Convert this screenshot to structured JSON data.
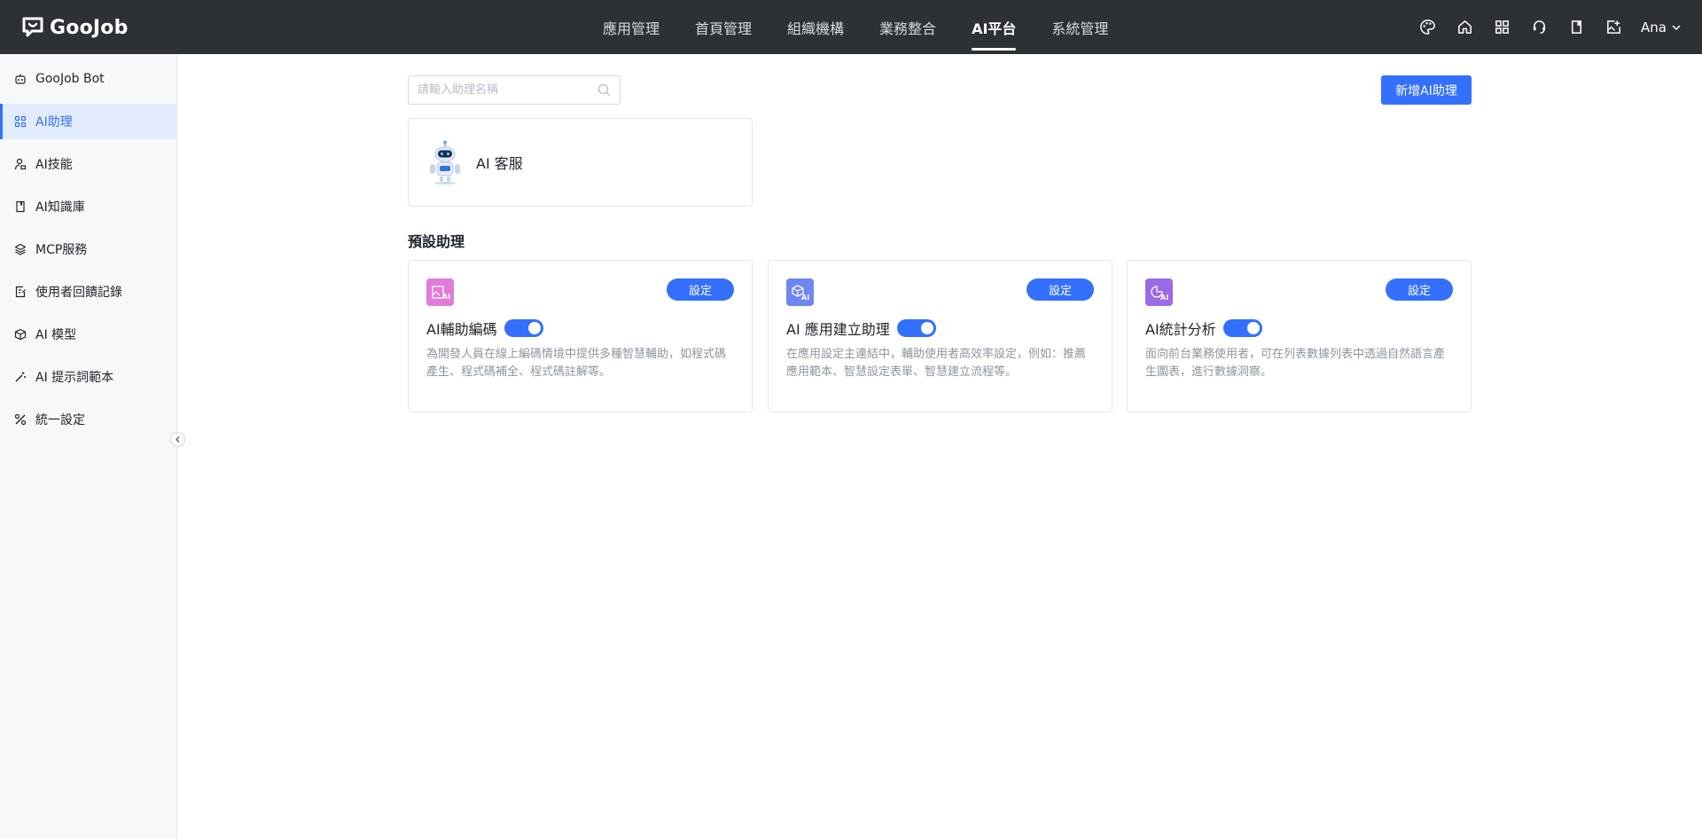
{
  "brand": {
    "name": "GooJob"
  },
  "nav": {
    "items": [
      {
        "label": "應用管理",
        "active": false
      },
      {
        "label": "首頁管理",
        "active": false
      },
      {
        "label": "組織機構",
        "active": false
      },
      {
        "label": "業務整合",
        "active": false
      },
      {
        "label": "AI平台",
        "active": true
      },
      {
        "label": "系統管理",
        "active": false
      }
    ]
  },
  "header_icons": [
    "palette-icon",
    "home-icon",
    "grid-icon",
    "support-icon",
    "book-icon",
    "image-edit-icon"
  ],
  "user": {
    "name": "Ana"
  },
  "sidebar": {
    "items": [
      {
        "label": "GooJob Bot",
        "icon": "robot-icon",
        "active": false
      },
      {
        "label": "AI助理",
        "icon": "apps-icon",
        "active": true
      },
      {
        "label": "AI技能",
        "icon": "skill-icon",
        "active": false
      },
      {
        "label": "AI知識庫",
        "icon": "book-icon",
        "active": false
      },
      {
        "label": "MCP服務",
        "icon": "layers-icon",
        "active": false
      },
      {
        "label": "使用者回饋記錄",
        "icon": "feedback-icon",
        "active": false
      },
      {
        "label": "AI 模型",
        "icon": "cube-icon",
        "active": false
      },
      {
        "label": "AI 提示詞範本",
        "icon": "wand-icon",
        "active": false
      },
      {
        "label": "統一設定",
        "icon": "tools-icon",
        "active": false
      }
    ]
  },
  "search": {
    "placeholder": "請輸入助理名稱",
    "value": ""
  },
  "add_button": {
    "label": "新增AI助理"
  },
  "assistants": [
    {
      "name": "AI 客服",
      "icon": "robot-avatar-icon"
    }
  ],
  "presets_title": "預設助理",
  "presets": [
    {
      "name": "AI輔助編碼",
      "desc": "為開發人員在線上編碼情境中提供多種智慧輔助，如程式碼產生、程式碼補全、程式碼註解等。",
      "button": "設定",
      "enabled": true,
      "color": "#e27bd6",
      "icon": "image-ai-icon"
    },
    {
      "name": "AI 應用建立助理",
      "desc": "在應用設定主連結中，輔助使用者高效率設定，例如：推薦應用範本、智慧設定表單、智慧建立流程等。",
      "button": "設定",
      "enabled": true,
      "color": "#6f86f2",
      "icon": "cube-ai-icon"
    },
    {
      "name": "AI統計分析",
      "desc": "面向前台業務使用者，可在列表數據列表中透過自然語言產生圖表，進行數據洞察。",
      "button": "設定",
      "enabled": true,
      "color": "#9b6ae6",
      "icon": "chart-ai-icon"
    }
  ],
  "colors": {
    "accent": "#3370ff",
    "topbar": "#2d3035",
    "sidebar": "#f7f8fa"
  }
}
